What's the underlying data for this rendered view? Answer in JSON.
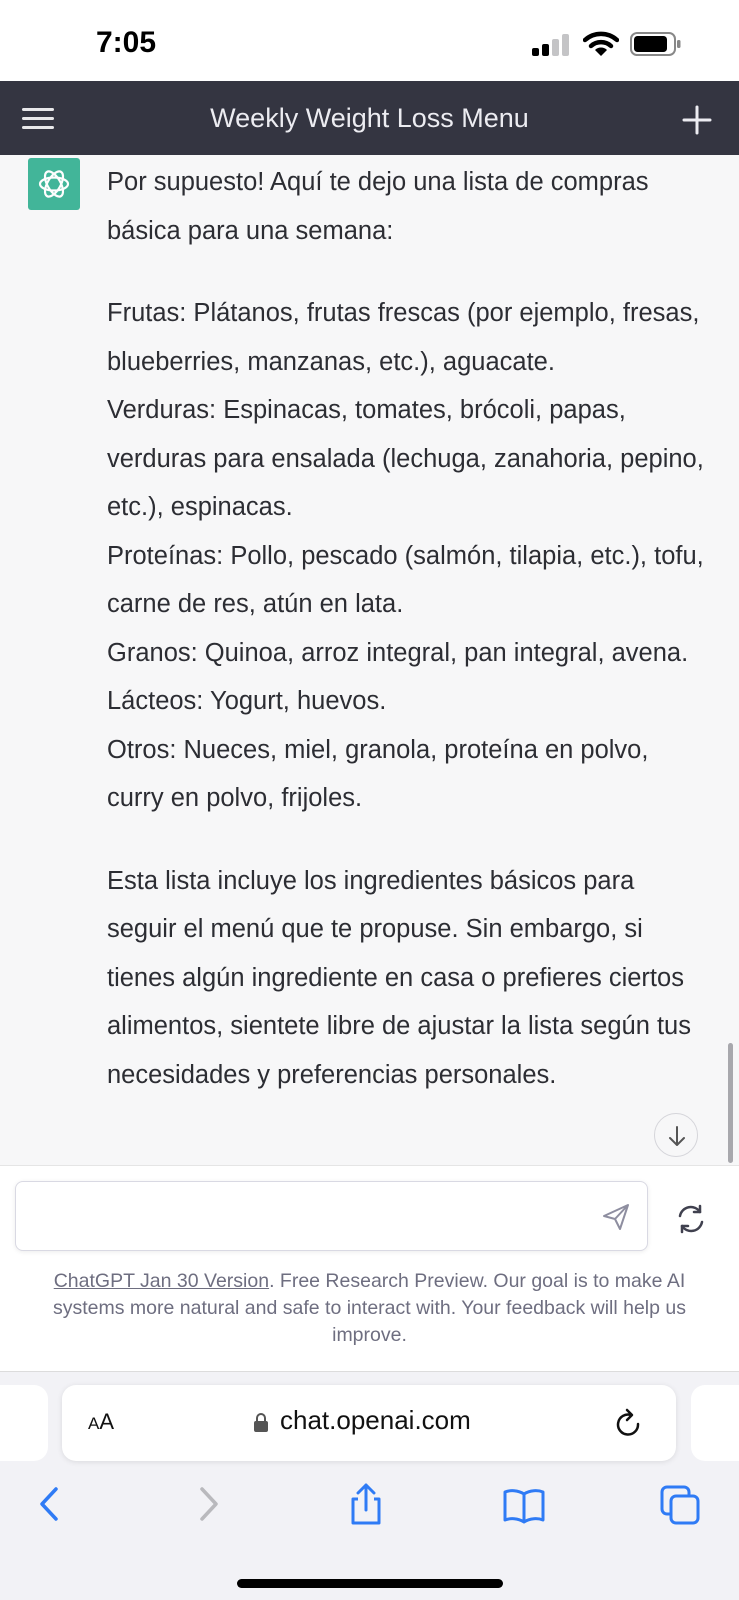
{
  "status_bar": {
    "time": "7:05"
  },
  "nav": {
    "title": "Weekly Weight Loss Menu"
  },
  "chat": {
    "message_paragraphs": [
      [
        "Por supuesto! Aquí te dejo una lista de compras básica para una semana:"
      ],
      [
        "Frutas: Plátanos, frutas frescas (por ejemplo, fresas, blueberries, manzanas, etc.), aguacate.",
        "Verduras: Espinacas, tomates, brócoli, papas, verduras para ensalada (lechuga, zanahoria, pepino, etc.), espinacas.",
        "Proteínas: Pollo, pescado (salmón, tilapia, etc.), tofu, carne de res, atún en lata.",
        "Granos: Quinoa, arroz integral, pan integral, avena.",
        "Lácteos: Yogurt, huevos.",
        "Otros: Nueces, miel, granola, proteína en polvo, curry en polvo, frijoles."
      ],
      [
        "Esta lista incluye los ingredientes básicos para seguir el menú que te propuse. Sin embargo, si tienes algún ingrediente en casa o prefieres ciertos alimentos, sientete libre de ajustar la lista según tus necesidades y preferencias personales."
      ]
    ]
  },
  "input": {
    "value": ""
  },
  "footer": {
    "link_text": "ChatGPT Jan 30 Version",
    "text": ". Free Research Preview. Our goal is to make AI systems more natural and safe to interact with. Your feedback will help us improve."
  },
  "browser": {
    "aa_label_small": "A",
    "aa_label_large": "A",
    "url": "chat.openai.com"
  },
  "colors": {
    "accent": "#10a37f",
    "nav_bg": "#343541",
    "safari_blue": "#2f7bf5"
  }
}
